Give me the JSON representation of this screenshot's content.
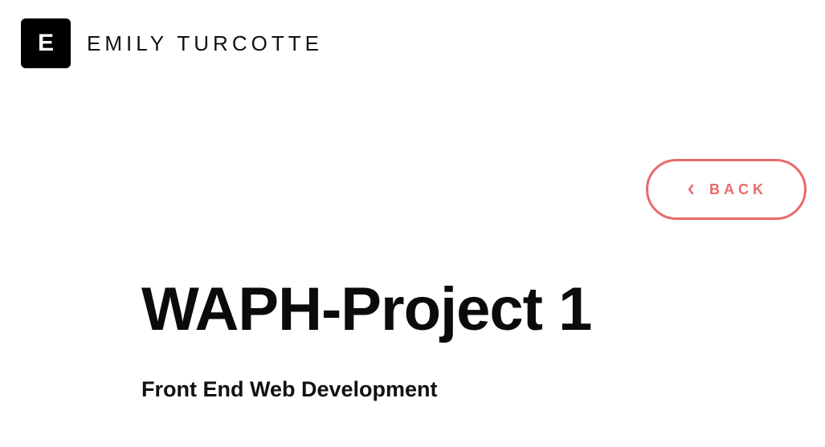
{
  "header": {
    "logo_letter": "E",
    "site_name": "EMILY TURCOTTE"
  },
  "back_button": {
    "label": "BACK",
    "icon": "chevron-left-icon",
    "color": "#e96a6a"
  },
  "main": {
    "title": "WAPH-Project 1",
    "subtitle": "Front End Web Development"
  }
}
